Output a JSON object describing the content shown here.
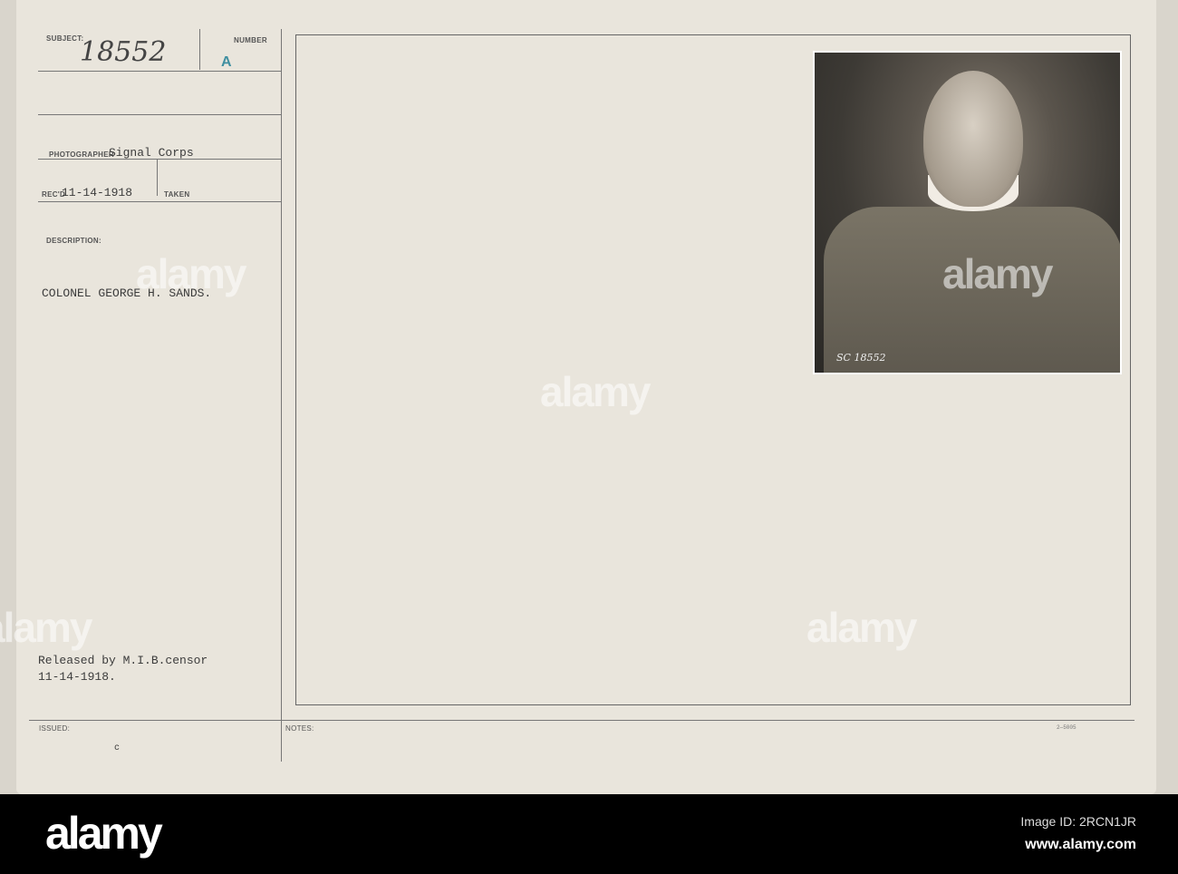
{
  "card": {
    "subject_label": "SUBJECT:",
    "subject_value": "18552",
    "number_label": "NUMBER",
    "number_value": "A",
    "photographer_label": "PHOTOGRAPHER",
    "photographer_value": "Signal Corps",
    "received_label": "REC'D",
    "received_value": "11-14-1918",
    "taken_label": "TAKEN",
    "description_label": "DESCRIPTION:",
    "description_value": "COLONEL GEORGE H. SANDS.",
    "release_line1": "Released by M.I.B.censor",
    "release_line2": "11-14-1918.",
    "issued_label": "ISSUED:",
    "issued_mark": "c",
    "notes_label": "NOTES:",
    "form_number": "2—5005"
  },
  "photo": {
    "negative_number": "SC 18552"
  },
  "watermark": {
    "text": "alamy"
  },
  "footer": {
    "logo": "alamy",
    "image_id": "Image ID: 2RCN1JR",
    "url": "www.alamy.com"
  }
}
